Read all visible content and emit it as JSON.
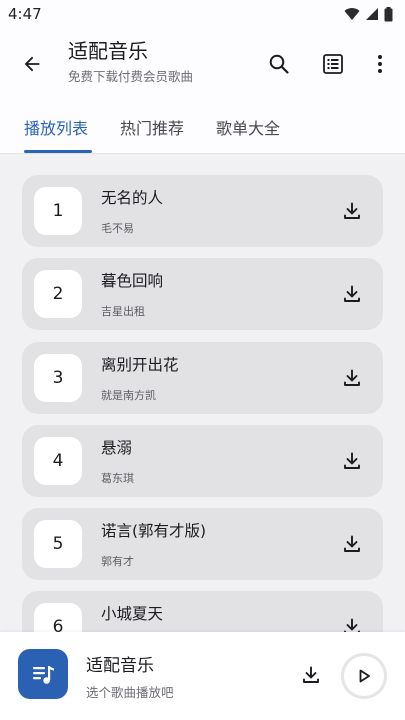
{
  "status_bar": {
    "time": "4:47",
    "icons": [
      "wifi-icon",
      "signal-icon",
      "battery-icon"
    ]
  },
  "app_bar": {
    "title": "适配音乐",
    "subtitle": "免费下载付费会员歌曲",
    "icons": [
      "back-arrow-icon",
      "search-icon",
      "list-icon",
      "more-vert-icon"
    ]
  },
  "tabs": [
    {
      "label": "播放列表",
      "active": true
    },
    {
      "label": "热门推荐",
      "active": false
    },
    {
      "label": "歌单大全",
      "active": false
    }
  ],
  "songs": [
    {
      "number": "1",
      "title": "无名的人",
      "artist": "毛不易"
    },
    {
      "number": "2",
      "title": "暮色回响",
      "artist": "吉星出租"
    },
    {
      "number": "3",
      "title": "离别开出花",
      "artist": "就是南方凯"
    },
    {
      "number": "4",
      "title": "悬溺",
      "artist": "葛东琪"
    },
    {
      "number": "5",
      "title": "诺言(郭有才版)",
      "artist": "郭有才"
    },
    {
      "number": "6",
      "title": "小城夏天",
      "artist": ""
    }
  ],
  "player": {
    "title": "适配音乐",
    "subtitle": "选个歌曲播放吧",
    "icons": [
      "music-note-list-icon",
      "download-icon",
      "play-icon"
    ]
  },
  "colors": {
    "accent": "#2b63b5",
    "card": "#e2e2e5",
    "list_background": "#f1f1f3",
    "album_art": "#2a61b3"
  }
}
